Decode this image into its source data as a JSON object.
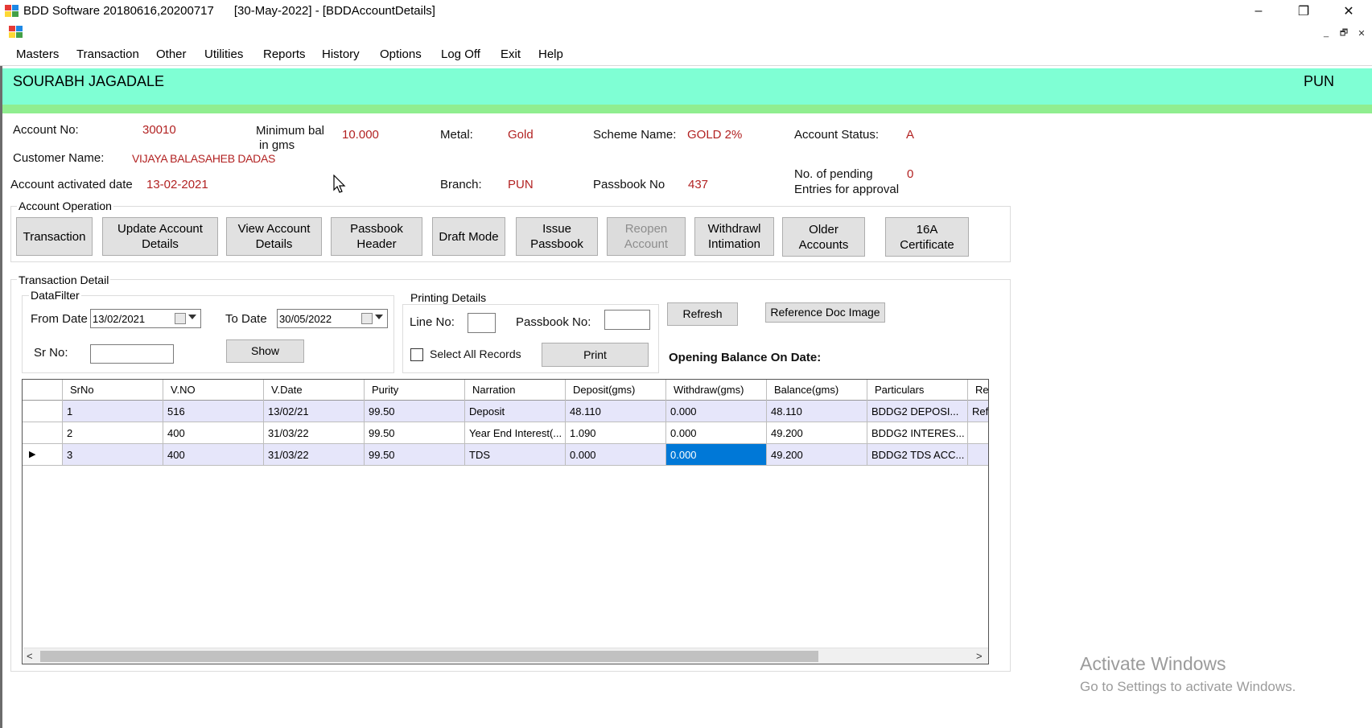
{
  "window": {
    "title": "BDD Software 20180616,20200717      [30-May-2022] - [BDDAccountDetails]",
    "controls": {
      "minimize": "–",
      "restore": "❐",
      "close": "✕"
    },
    "mdi_controls": {
      "minimize": "_",
      "restore": "🗗",
      "close": "✕"
    }
  },
  "menu": [
    "Masters",
    "Transaction",
    "Other",
    "Utilities",
    "Reports",
    "History",
    "Options",
    "Log Off",
    "Exit",
    "Help"
  ],
  "banner": {
    "customer": "SOURABH JAGADALE",
    "branch_code": "PUN"
  },
  "account": {
    "account_no_label": "Account No:",
    "account_no": "30010",
    "min_bal_label_1": "Minimum bal",
    "min_bal_label_2": "in gms",
    "min_bal": "10.000",
    "metal_label": "Metal:",
    "metal": "Gold",
    "scheme_label": "Scheme Name:",
    "scheme": "GOLD 2%",
    "status_label": "Account Status:",
    "status": "A",
    "customer_label": "Customer Name:",
    "customer": "VIJAYA BALASAHEB DADAS",
    "activated_label": "Account activated date",
    "activated": "13-02-2021",
    "branch_label": "Branch:",
    "branch": "PUN",
    "passbook_label": "Passbook No",
    "passbook": "437",
    "pending_label_1": "No. of pending",
    "pending_label_2": "Entries for approval",
    "pending": "0"
  },
  "operations": {
    "title": "Account Operation",
    "buttons": {
      "transaction": "Transaction",
      "update_1": "Update Account",
      "update_2": "Details",
      "view_1": "View Account",
      "view_2": "Details",
      "passbook_header_1": "Passbook",
      "passbook_header_2": "Header",
      "draft": "Draft Mode",
      "issue_1": "Issue",
      "issue_2": "Passbook",
      "reopen_1": "Reopen",
      "reopen_2": "Account",
      "withdrawl_1": "Withdrawl",
      "withdrawl_2": "Intimation",
      "older_1": "Older",
      "older_2": "Accounts",
      "cert_1": "16A",
      "cert_2": "Certificate"
    }
  },
  "transaction_detail": {
    "title": "Transaction Detail",
    "datafilter": {
      "title": "DataFilter",
      "from_label": "From Date",
      "from_value": "13/02/2021",
      "to_label": "To Date",
      "to_value": "30/05/2022",
      "srno_label": "Sr No:",
      "srno_value": "",
      "show": "Show"
    },
    "printing": {
      "title": "Printing Details",
      "line_label": "Line No:",
      "line_value": "",
      "passbook_label": "Passbook No:",
      "passbook_value": "",
      "select_all": "Select All Records",
      "print": "Print"
    },
    "refresh": "Refresh",
    "ref_doc": "Reference Doc Image",
    "opening_balance": "Opening Balance On Date:"
  },
  "grid": {
    "columns": [
      "SrNo",
      "V.NO",
      "V.Date",
      "Purity",
      "Narration",
      "Deposit(gms)",
      "Withdraw(gms)",
      "Balance(gms)",
      "Particulars",
      "Re"
    ],
    "current_row_marker": "▶",
    "rows": [
      [
        "1",
        "516",
        "13/02/21",
        "99.50",
        "Deposit",
        "48.110",
        "0.000",
        "48.110",
        "BDDG2 DEPOSI...",
        "Ref"
      ],
      [
        "2",
        "400",
        "31/03/22",
        "99.50",
        "Year End Interest(...",
        "1.090",
        "0.000",
        "49.200",
        "BDDG2 INTERES...",
        ""
      ],
      [
        "3",
        "400",
        "31/03/22",
        "99.50",
        "TDS",
        "0.000",
        "0.000",
        "49.200",
        "BDDG2 TDS ACC...",
        ""
      ]
    ],
    "scroll_left": "<",
    "scroll_right": ">"
  },
  "watermark": {
    "line1": "Activate Windows",
    "line2": "Go to Settings to activate Windows."
  }
}
